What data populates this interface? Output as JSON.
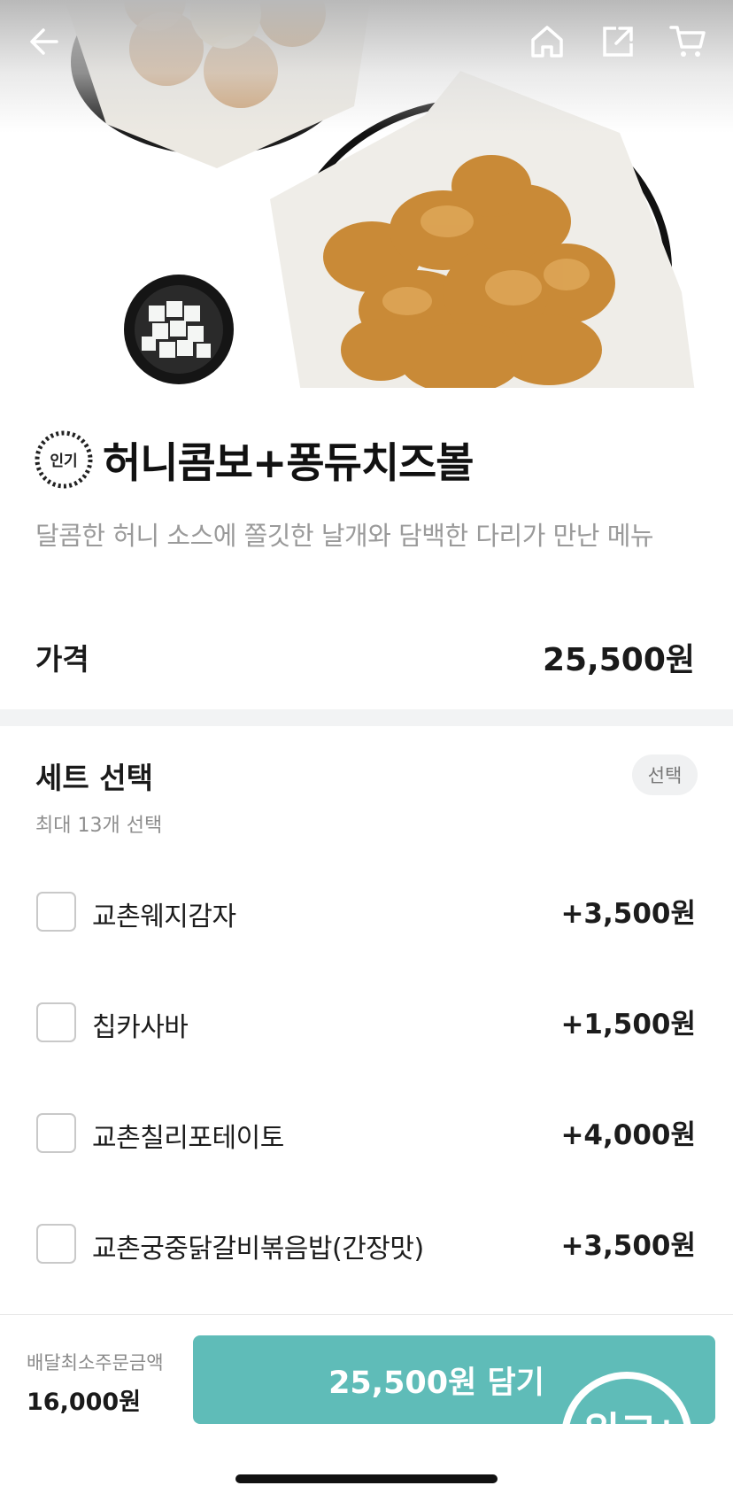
{
  "icons": {
    "back": "arrow-left-icon",
    "home": "home-icon",
    "share": "share-icon",
    "cart": "cart-icon",
    "popular": "popular-badge-icon"
  },
  "product": {
    "badge": "인기",
    "title": "허니콤보+퐁듀치즈볼",
    "description": "달콤한 허니 소스에 쫄깃한 날개와 담백한 다리가 만난 메뉴"
  },
  "price": {
    "label": "가격",
    "value": "25,500원"
  },
  "set": {
    "title": "세트 선택",
    "badge": "선택",
    "subtitle": "최대 13개 선택",
    "options": [
      {
        "label": "교촌웨지감자",
        "price": "+3,500원",
        "checked": false
      },
      {
        "label": "칩카사바",
        "price": "+1,500원",
        "checked": false
      },
      {
        "label": "교촌칠리포테이토",
        "price": "+4,000원",
        "checked": false
      },
      {
        "label": "교촌궁중닭갈비볶음밥(간장맛)",
        "price": "+3,500원",
        "checked": false
      }
    ]
  },
  "bottom": {
    "min_order_label": "배달최소주문금액",
    "min_order_value": "16,000원",
    "add_button": "25,500원 담기",
    "watermark_text": "워그ㅂ"
  },
  "colors": {
    "accent": "#5fbcb8",
    "text": "#1a1a1a",
    "muted": "#9a9a9a"
  }
}
